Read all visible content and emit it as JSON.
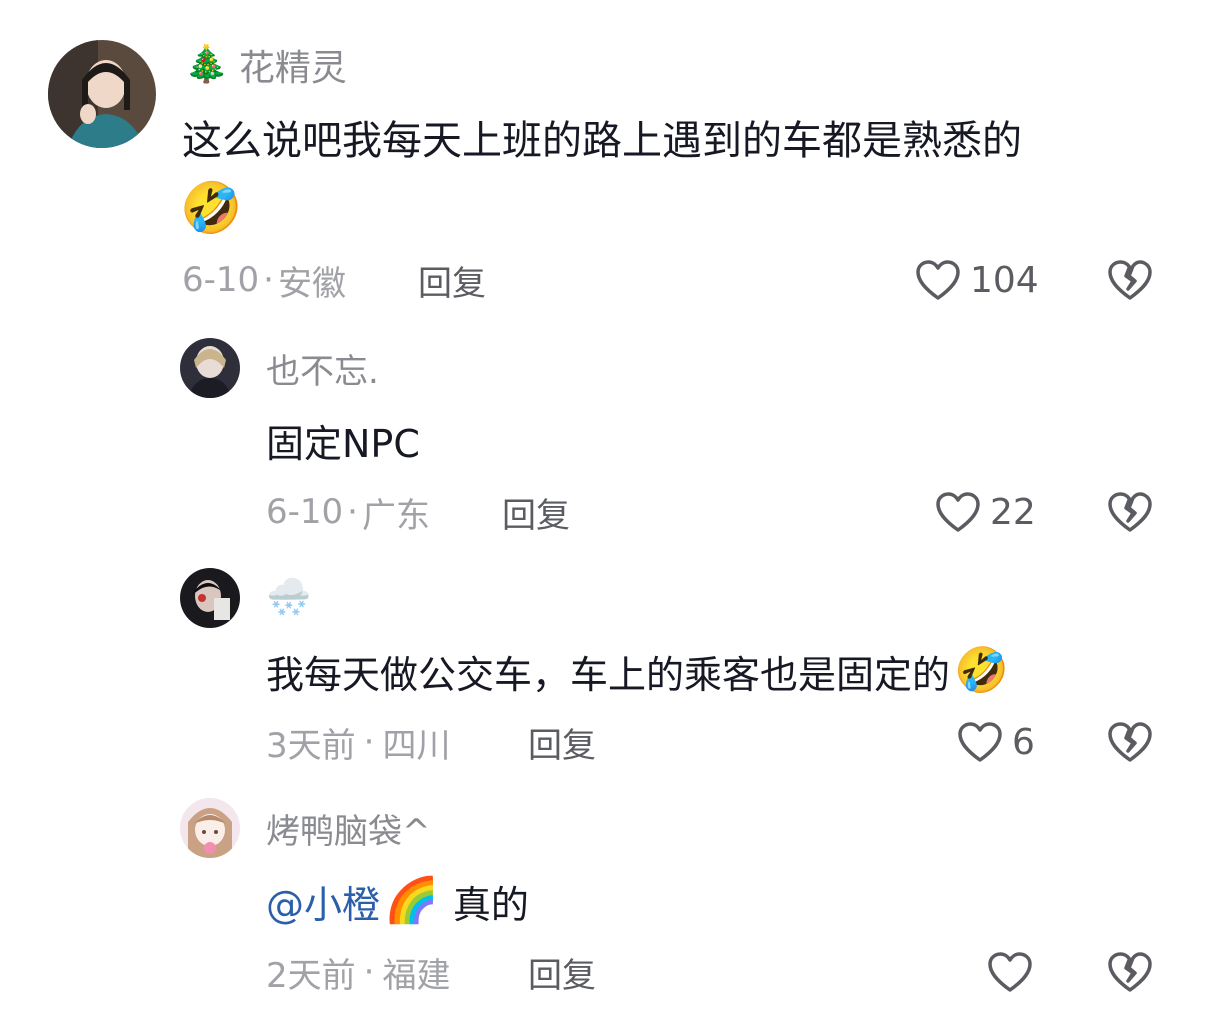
{
  "comments": [
    {
      "username": "花精灵",
      "name_emoji": "🎄",
      "text": "这么说吧我每天上班的路上遇到的车都是熟悉的",
      "text_emoji": "🤣",
      "date": "6-10",
      "location": "安徽",
      "reply_label": "回复",
      "likes": "104"
    },
    {
      "username": "也不忘.",
      "text": "固定NPC",
      "date": "6-10",
      "location": "广东",
      "reply_label": "回复",
      "likes": "22"
    },
    {
      "name_emoji": "🌨️",
      "text": "我每天做公交车，车上的乘客也是固定的",
      "text_emoji": "🤣",
      "date": "3天前",
      "location": "四川",
      "reply_label": "回复",
      "likes": "6"
    },
    {
      "username": "烤鸭脑袋^",
      "mention": "@小橙",
      "mention_emoji": "🌈",
      "text": "真的",
      "date": "2天前",
      "location": "福建",
      "reply_label": "回复"
    }
  ],
  "separator": "·",
  "icons": {
    "like": "heart-outline-icon",
    "dislike": "broken-heart-icon"
  },
  "colors": {
    "username": "#8a8b91",
    "meta": "#a1a2a7",
    "mention": "#2b5fab",
    "icon": "#5b5c61"
  }
}
